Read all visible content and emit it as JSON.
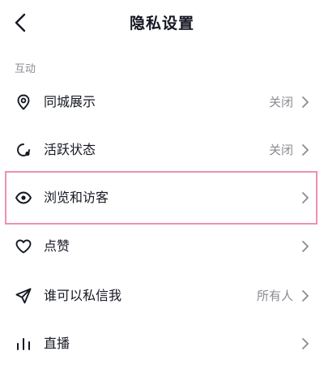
{
  "header": {
    "title": "隐私设置"
  },
  "section": {
    "label": "互动"
  },
  "rows": [
    {
      "label": "同城展示",
      "value": "关闭",
      "icon": "location-pin-icon"
    },
    {
      "label": "活跃状态",
      "value": "关闭",
      "icon": "activity-status-icon"
    },
    {
      "label": "浏览和访客",
      "value": "",
      "icon": "eye-icon"
    },
    {
      "label": "点赞",
      "value": "",
      "icon": "heart-icon"
    },
    {
      "label": "谁可以私信我",
      "value": "所有人",
      "icon": "send-message-icon"
    },
    {
      "label": "直播",
      "value": "",
      "icon": "live-bars-icon"
    }
  ],
  "colors": {
    "text": "#161823",
    "secondary": "#8a8b91",
    "highlight": "#ef90b5"
  }
}
